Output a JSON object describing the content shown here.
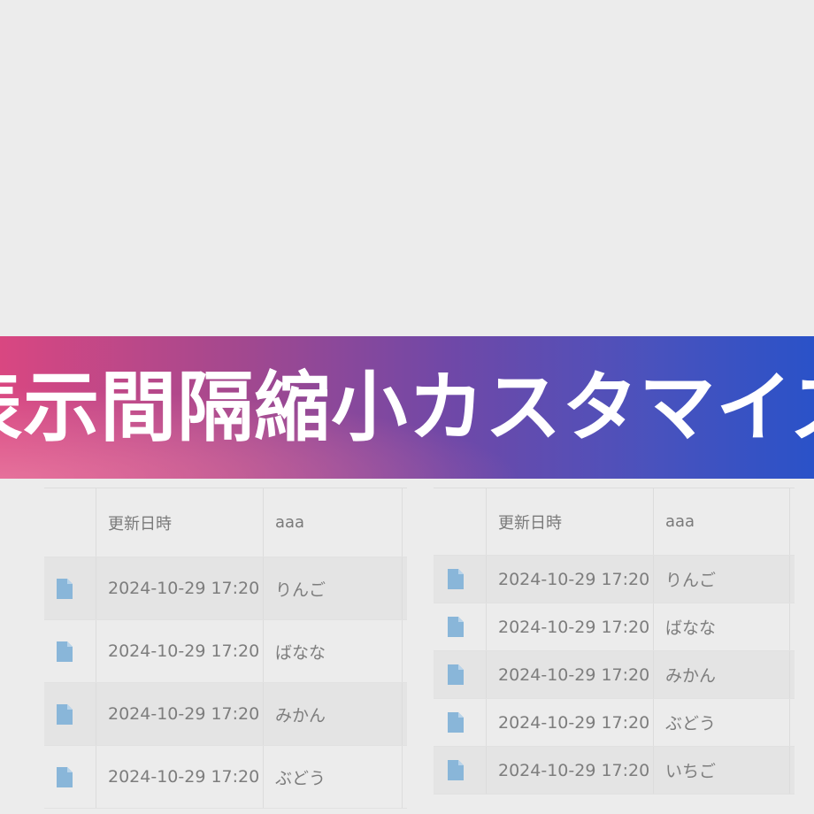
{
  "banner": {
    "title": "表示間隔縮小カスタマイズ"
  },
  "colors": {
    "background": "#ececec",
    "banner_start": "#d94781",
    "banner_end": "#2a52c8",
    "file_icon": "#89b6d9",
    "text": "#7d7d7d"
  },
  "table_left": {
    "columns": [
      "",
      "更新日時",
      "aaa"
    ],
    "rows": [
      {
        "icon": "file-icon",
        "date": "2024-10-29 17:20",
        "aaa": "りんご"
      },
      {
        "icon": "file-icon",
        "date": "2024-10-29 17:20",
        "aaa": "ばなな"
      },
      {
        "icon": "file-icon",
        "date": "2024-10-29 17:20",
        "aaa": "みかん"
      },
      {
        "icon": "file-icon",
        "date": "2024-10-29 17:20",
        "aaa": "ぶどう"
      }
    ]
  },
  "table_right": {
    "columns": [
      "",
      "更新日時",
      "aaa"
    ],
    "rows": [
      {
        "icon": "file-icon",
        "date": "2024-10-29 17:20",
        "aaa": "りんご"
      },
      {
        "icon": "file-icon",
        "date": "2024-10-29 17:20",
        "aaa": "ばなな"
      },
      {
        "icon": "file-icon",
        "date": "2024-10-29 17:20",
        "aaa": "みかん"
      },
      {
        "icon": "file-icon",
        "date": "2024-10-29 17:20",
        "aaa": "ぶどう"
      },
      {
        "icon": "file-icon",
        "date": "2024-10-29 17:20",
        "aaa": "いちご"
      }
    ]
  }
}
